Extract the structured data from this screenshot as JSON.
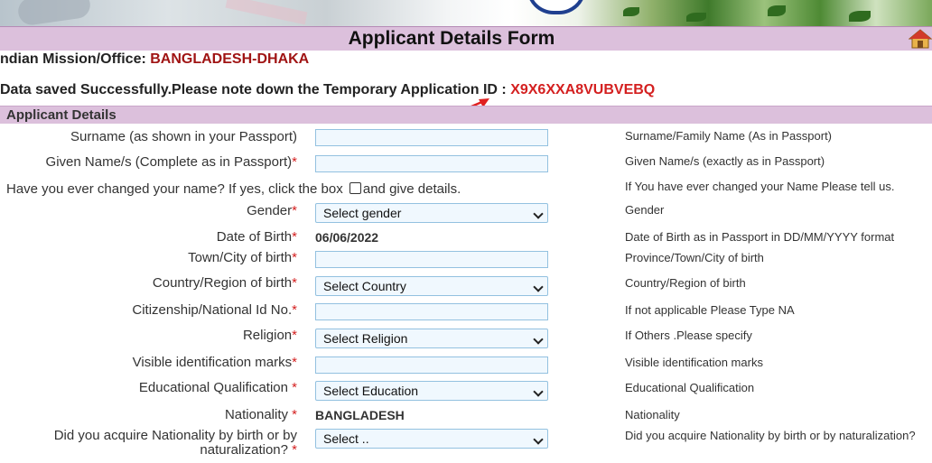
{
  "page": {
    "title": "Applicant Details Form",
    "mission_label": "ndian Mission/Office: ",
    "mission_value": "BANGLADESH-DHAKA",
    "saved_message": "Data saved Successfully.Please note down the Temporary Application ID : ",
    "application_id": "X9X6XXA8VUBVEBQ",
    "section_title": "Applicant Details"
  },
  "form": {
    "surname_label": "Surname (as shown in your Passport)",
    "surname_value": "",
    "surname_help": "Surname/Family Name (As in Passport)",
    "given_label": "Given Name/s (Complete as in Passport)",
    "given_req": "*",
    "given_value": "",
    "given_help": "Given Name/s (exactly as in Passport)",
    "changed_text_before": "Have you ever changed your name? If yes, click the box ",
    "changed_text_after": "and give details.",
    "changed_help": "If You have ever changed your Name Please tell us.",
    "gender_label": "Gender",
    "gender_req": "*",
    "gender_value": "Select gender",
    "gender_help": "Gender",
    "dob_label": "Date of Birth",
    "dob_req": "*",
    "dob_value": "06/06/2022",
    "dob_help": "Date of Birth as in Passport in DD/MM/YYYY format",
    "town_label": "Town/City of birth",
    "town_req": "*",
    "town_value": "",
    "town_help": "Province/Town/City of birth",
    "country_label": "Country/Region of birth",
    "country_req": "*",
    "country_value": "Select Country",
    "country_help": "Country/Region of birth",
    "citizenship_label": "Citizenship/National Id No.",
    "citizenship_req": "*",
    "citizenship_value": "",
    "citizenship_help": "If not applicable Please Type NA",
    "religion_label": "Religion",
    "religion_req": "*",
    "religion_value": "Select Religion",
    "religion_help": "If Others .Please specify",
    "marks_label": "Visible identification marks",
    "marks_req": "*",
    "marks_value": "",
    "marks_help": "Visible identification marks",
    "education_label": "Educational Qualification ",
    "education_req": "*",
    "education_value": "Select Education",
    "education_help": "Educational Qualification",
    "nationality_label": "Nationality ",
    "nationality_req": "*",
    "nationality_value": "BANGLADESH",
    "nationality_help": "Nationality",
    "acquire_label_line1": "Did you acquire Nationality by birth or by",
    "acquire_label_line2": "naturalization? ",
    "acquire_req": "*",
    "acquire_value": "Select ..",
    "acquire_help": "Did you acquire Nationality by birth or by naturalization?"
  },
  "colors": {
    "header_band": "#dcc0dc",
    "mission_value": "#a01414",
    "application_id": "#d42020",
    "input_border": "#93c1e0",
    "input_bg": "#f0f8fe"
  },
  "icons": [
    "home-icon",
    "arrow-icon",
    "chevron-down-icon"
  ]
}
